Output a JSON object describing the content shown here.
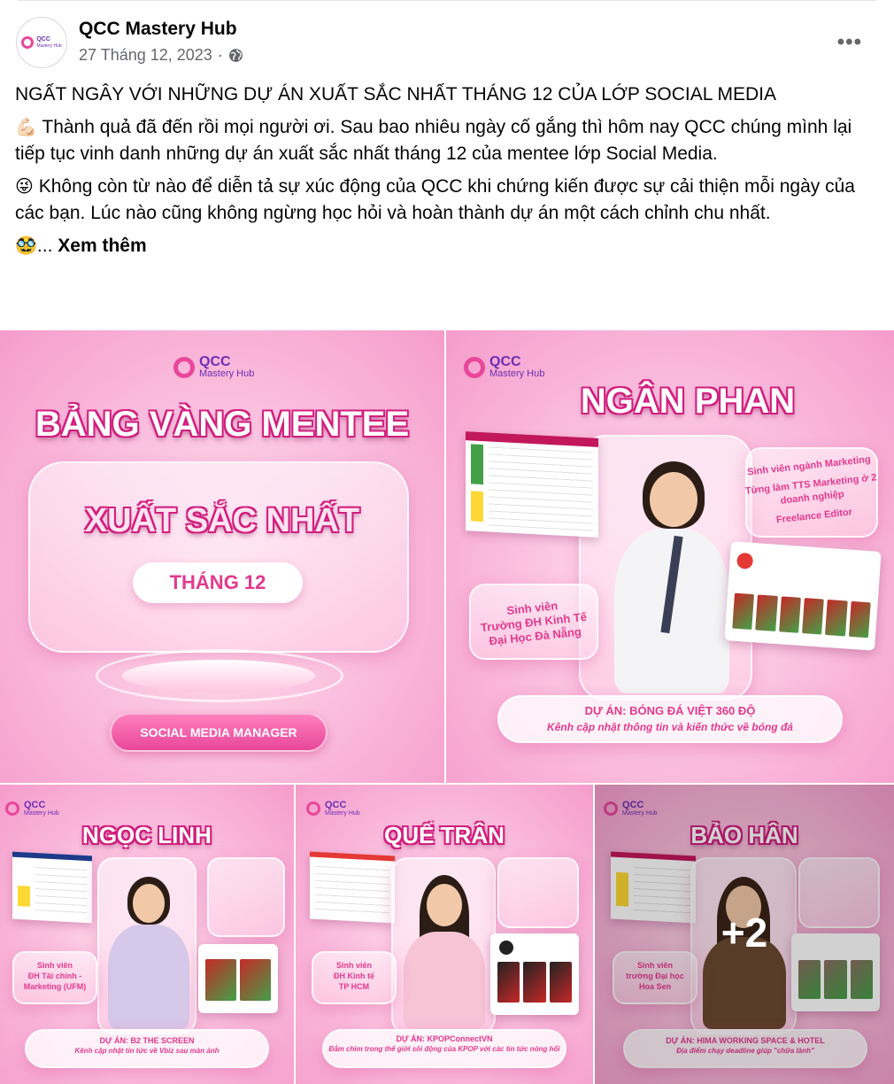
{
  "post": {
    "page_name": "QCC Mastery Hub",
    "date": "27 Tháng 12, 2023",
    "separator": "·",
    "privacy_icon": "globe-icon",
    "more_icon": "more-options-icon",
    "more_label": "•••",
    "title": "NGẤT NGÂY VỚI NHỮNG DỰ ÁN XUẤT SẮC NHẤT THÁNG 12 CỦA LỚP SOCIAL MEDIA",
    "para1_emoji": "💪🏻",
    "para1": "Thành quả đã đến rồi mọi người ơi. Sau bao nhiêu ngày cố gắng thì hôm nay QCC chúng mình lại tiếp tục vinh danh những dự án xuất sắc nhất tháng 12 của mentee lớp Social Media.",
    "para2_emoji": "😜",
    "para2": "Không còn từ nào để diễn tả sự xúc động của QCC khi chứng kiến được sự cải thiện mỗi ngày của các bạn.  Lúc nào cũng không ngừng học hỏi và hoàn thành dự án một cách chỉnh chu nhất.",
    "para3_emoji": "🥸",
    "ellipsis": "...",
    "see_more": "Xem thêm"
  },
  "brand": {
    "name": "QCC",
    "sub": "Mastery Hub"
  },
  "tile1": {
    "headline": "BẢNG VÀNG MENTEE",
    "main": "XUẤT SẮC NHẤT",
    "month": "THÁNG 12",
    "role": "SOCIAL MEDIA MANAGER"
  },
  "tile2": {
    "name": "NGÂN PHAN",
    "info": [
      "Sinh viên ngành Marketing",
      "Từng làm TTS Marketing ở 2 doanh nghiệp",
      "Freelance Editor"
    ],
    "school": [
      "Sinh viên",
      "Trường ĐH Kinh Tế",
      "Đại Học Đà Nẵng"
    ],
    "project_title": "DỰ ÁN: BÓNG ĐÁ VIỆT 360 ĐỘ",
    "project_desc": "Kênh cập nhật thông tin và kiến thức về bóng đá"
  },
  "tile3": {
    "name": "NGỌC LINH",
    "school": [
      "Sinh viên",
      "ĐH Tài chính -",
      "Marketing (UFM)"
    ],
    "project_title": "DỰ ÁN: B2 THE SCREEN",
    "project_desc": "Kênh cập nhật tin tức về Vbiz sau màn ảnh"
  },
  "tile4": {
    "name": "QUẾ TRÂN",
    "school": [
      "Sinh viên",
      "ĐH Kinh tế",
      "TP HCM"
    ],
    "project_title": "DỰ ÁN: KPOPConnectVN",
    "project_desc": "Đắm chìm trong thế giới sôi động của KPOP với các tin tức nóng hổi"
  },
  "tile5": {
    "name": "BẢO HÂN",
    "school": [
      "Sinh viên",
      "trường Đại học",
      "Hoa Sen"
    ],
    "project_title": "DỰ ÁN: HIMA WORKING SPACE & HOTEL",
    "project_desc": "Địa điểm chạy deadline giúp \"chữa lành\"",
    "more_count": "+2"
  }
}
